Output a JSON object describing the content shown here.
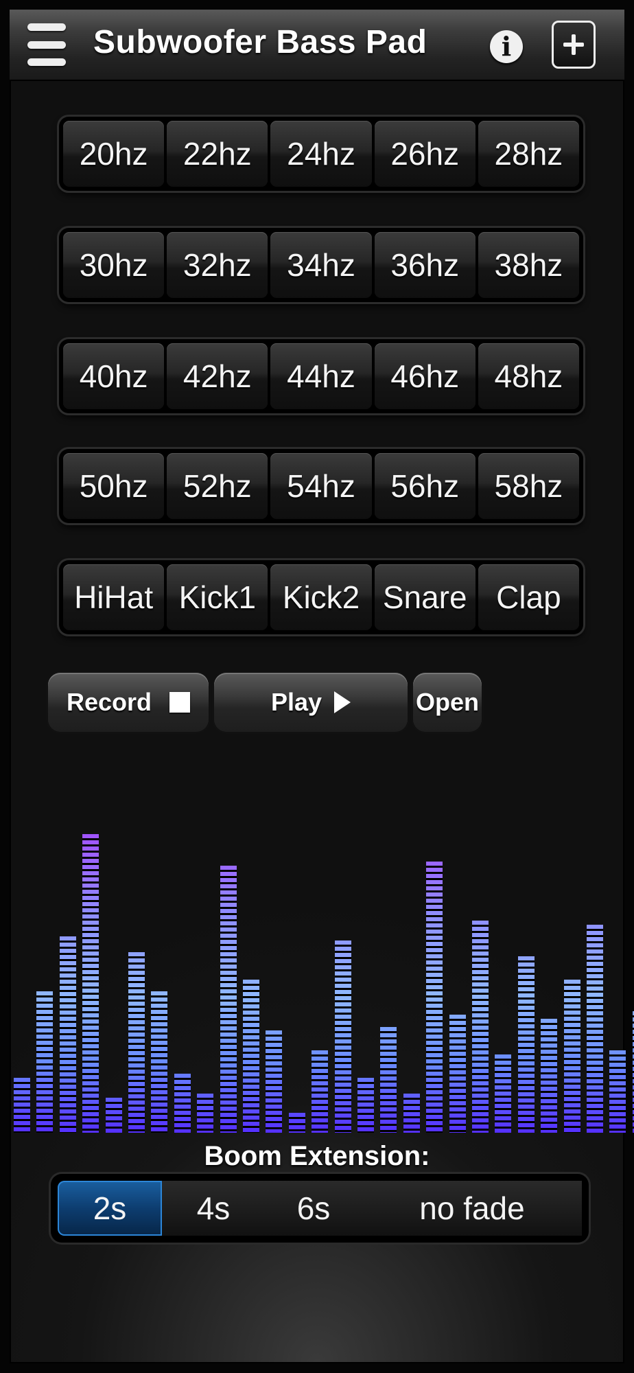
{
  "app": {
    "title": "Subwoofer Bass Pad",
    "info_icon": "info-icon",
    "add_icon": "plus-icon",
    "menu_icon": "hamburger-menu-icon"
  },
  "pads": {
    "rows": [
      [
        "20hz",
        "22hz",
        "24hz",
        "26hz",
        "28hz"
      ],
      [
        "30hz",
        "32hz",
        "34hz",
        "36hz",
        "38hz"
      ],
      [
        "40hz",
        "42hz",
        "44hz",
        "46hz",
        "48hz"
      ],
      [
        "50hz",
        "52hz",
        "54hz",
        "56hz",
        "58hz"
      ],
      [
        "HiHat",
        "Kick1",
        "Kick2",
        "Snare",
        "Clap"
      ]
    ]
  },
  "controls": {
    "record_label": "Record",
    "play_label": "Play",
    "open_label": "Open"
  },
  "equalizer": {
    "colors": {
      "low": "#5530ff",
      "mid": "#8fb7ff",
      "high": "#b040ff"
    },
    "levels": [
      0.14,
      0.36,
      0.5,
      0.76,
      0.09,
      0.46,
      0.36,
      0.15,
      0.1,
      0.68,
      0.39,
      0.26,
      0.05,
      0.21,
      0.49,
      0.14,
      0.27,
      0.1,
      0.69,
      0.3,
      0.54,
      0.2,
      0.45,
      0.29,
      0.39,
      0.53,
      0.21,
      0.31
    ]
  },
  "boom_extension": {
    "label": "Boom Extension:",
    "options": [
      "2s",
      "4s",
      "6s",
      "no fade"
    ],
    "selected": "2s"
  }
}
